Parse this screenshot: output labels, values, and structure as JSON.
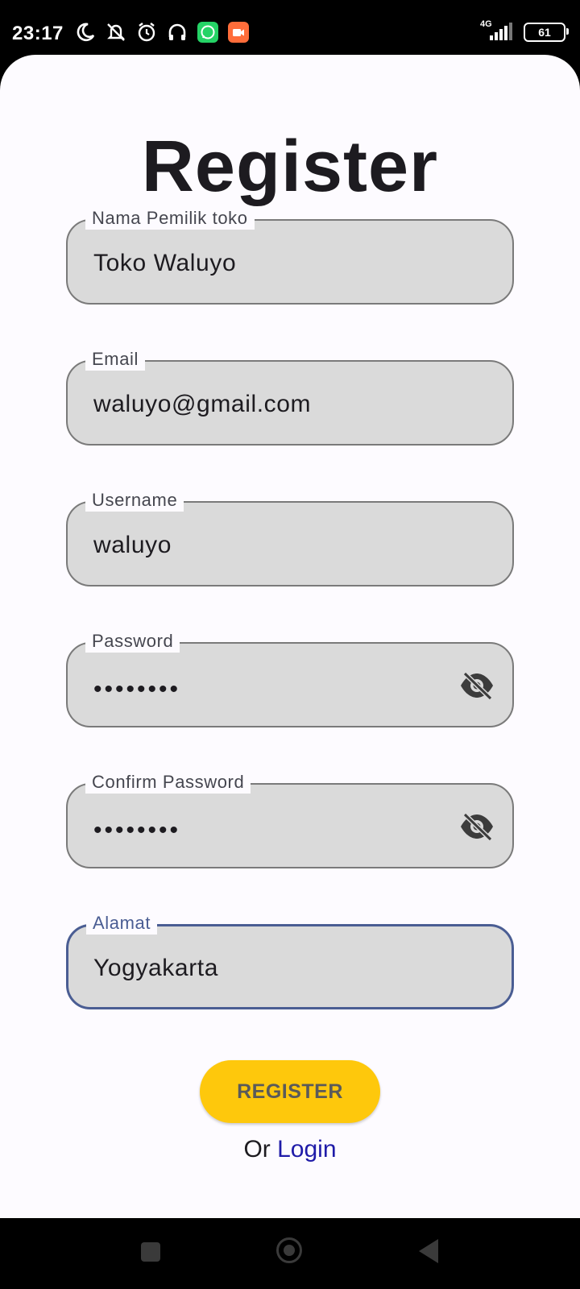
{
  "status_bar": {
    "time": "23:17",
    "network": "4G",
    "battery": "61",
    "icons": [
      "moon-icon",
      "mute-icon",
      "alarm-icon",
      "headset-icon",
      "whatsapp-icon",
      "video-icon",
      "signal-icon",
      "battery-icon"
    ]
  },
  "page": {
    "title": "Register"
  },
  "form": {
    "nama": {
      "label": "Nama Pemilik toko",
      "value": "Toko Waluyo"
    },
    "email": {
      "label": "Email",
      "value": "waluyo@gmail.com"
    },
    "username": {
      "label": "Username",
      "value": "waluyo"
    },
    "password": {
      "label": "Password",
      "value": "••••••••"
    },
    "confirm_password": {
      "label": "Confirm Password",
      "value": "••••••••"
    },
    "alamat": {
      "label": "Alamat",
      "value": "Yogyakarta"
    }
  },
  "actions": {
    "register_label": "REGISTER",
    "or_text": "Or",
    "login_label": "Login"
  },
  "colors": {
    "accent": "#fec80c",
    "focus": "#4a5d93",
    "field_bg": "#dadada",
    "link": "#1f1ba8"
  }
}
